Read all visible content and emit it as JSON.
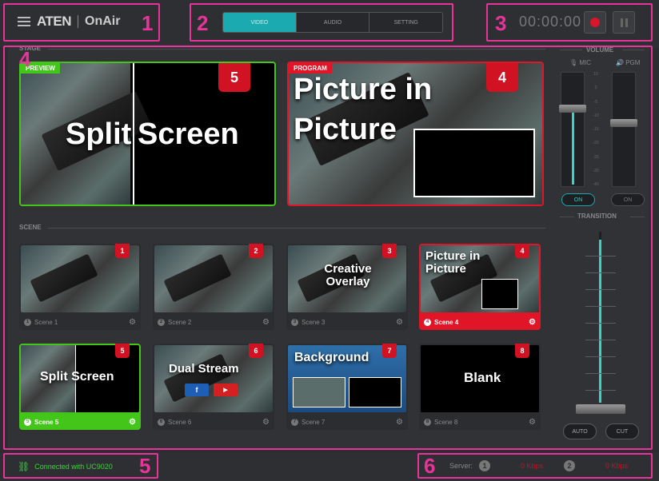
{
  "header": {
    "brand": "ATEN",
    "product": "OnAir",
    "tabs": [
      "VIDEO",
      "AUDIO",
      "SETTING"
    ],
    "active_tab": "VIDEO",
    "timer": "00:00:00"
  },
  "stage": {
    "label": "STAGE",
    "preview": {
      "label": "PREVIEW",
      "badge": "5",
      "text1": "Split",
      "text2": "Screen"
    },
    "program": {
      "label": "PROGRAM",
      "badge": "4",
      "text1": "Picture in",
      "text2": "Picture"
    }
  },
  "scene": {
    "label": "SCENE",
    "items": [
      {
        "num": "1",
        "badge": "1",
        "name": "Scene 1",
        "overlay": ""
      },
      {
        "num": "2",
        "badge": "2",
        "name": "Scene 2",
        "overlay": ""
      },
      {
        "num": "3",
        "badge": "3",
        "name": "Scene 3",
        "overlay": "Creative Overlay"
      },
      {
        "num": "4",
        "badge": "4",
        "name": "Scene 4",
        "overlay": "Picture in Picture"
      },
      {
        "num": "5",
        "badge": "5",
        "name": "Scene 5",
        "overlay": "Split Screen"
      },
      {
        "num": "6",
        "badge": "6",
        "name": "Scene 6",
        "overlay": "Dual Stream"
      },
      {
        "num": "7",
        "badge": "7",
        "name": "Scene 7",
        "overlay": "Background"
      },
      {
        "num": "8",
        "badge": "8",
        "name": "Scene 8",
        "overlay": "Blank"
      }
    ]
  },
  "volume": {
    "label": "VOLUME",
    "mic_label": "MIC",
    "pgm_label": "PGM",
    "mic_toggle": "ON",
    "pgm_toggle": "ON",
    "scale": [
      "10",
      "0",
      "-5",
      "-10",
      "-15",
      "-20",
      "-25",
      "-30",
      "-40"
    ]
  },
  "transition": {
    "label": "TRANSITION",
    "auto": "AUTO",
    "cut": "CUT"
  },
  "footer": {
    "status": "Connected with UC9020",
    "server_label": "Server:",
    "server1": "1",
    "server1_rate": "0 Kbps",
    "server2": "2",
    "server2_rate": "0 Kbps"
  },
  "callouts": [
    "1",
    "2",
    "3",
    "4",
    "5",
    "6"
  ],
  "colors": {
    "accent": "#1aaab0",
    "program": "#e01528",
    "preview": "#44c51a",
    "callout": "#e8349a"
  }
}
